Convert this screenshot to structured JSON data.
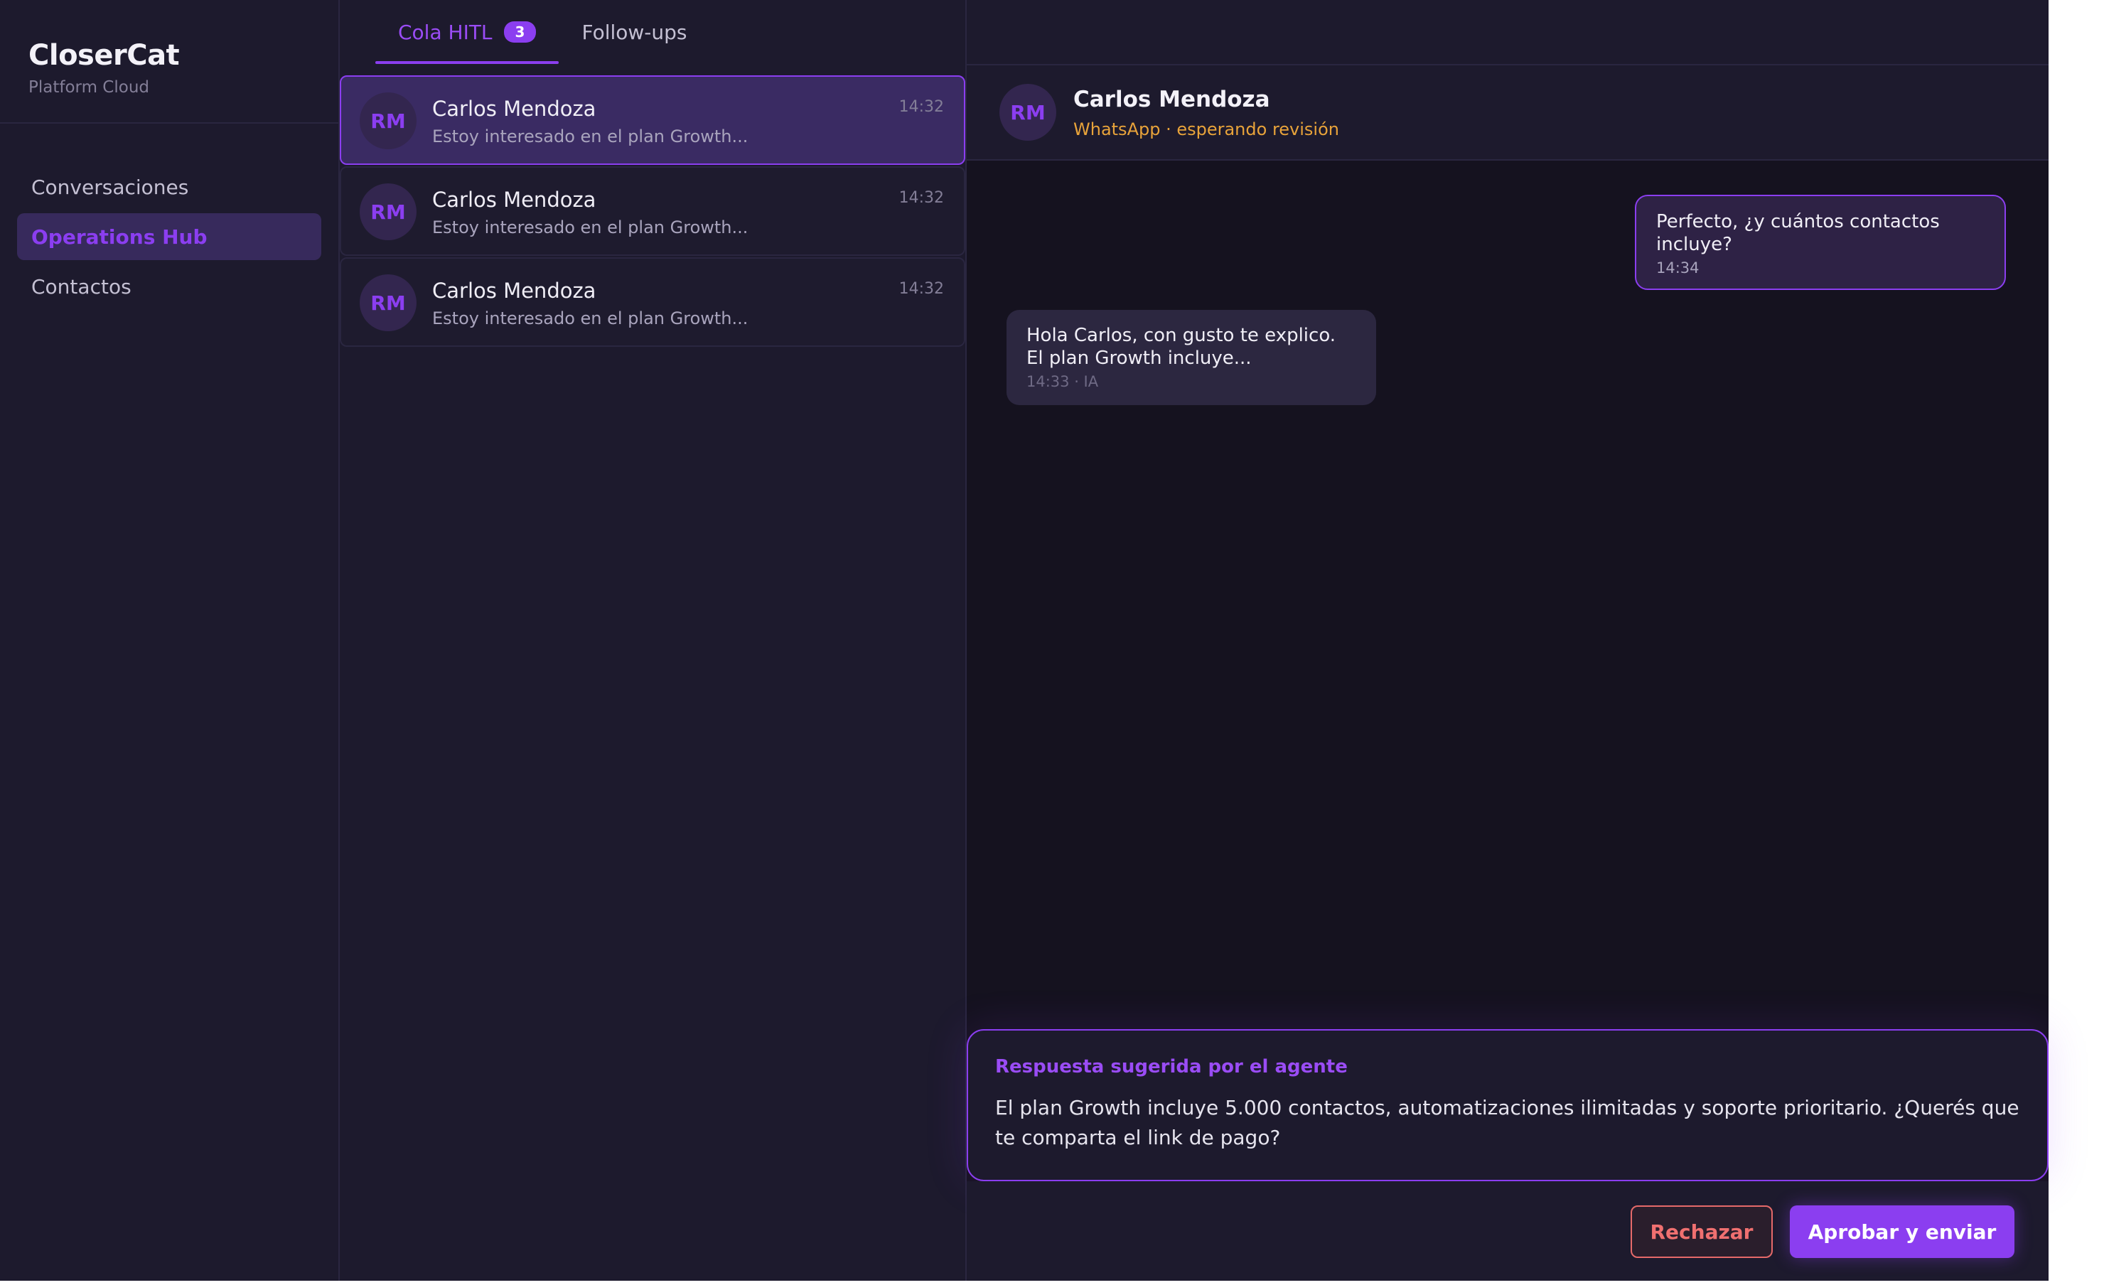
{
  "brand": {
    "title": "CloserCat",
    "subtitle": "Platform Cloud"
  },
  "nav": {
    "items": [
      {
        "label": "Conversaciones",
        "active": false
      },
      {
        "label": "Operations Hub",
        "active": true
      },
      {
        "label": "Contactos",
        "active": false
      }
    ]
  },
  "tabs": [
    {
      "label": "Cola HITL",
      "badge": "3",
      "active": true
    },
    {
      "label": "Follow-ups",
      "active": false
    }
  ],
  "conversations": [
    {
      "initials": "RM",
      "name": "Carlos Mendoza",
      "preview": "Estoy interesado en el plan Growth...",
      "time": "14:32",
      "selected": true
    },
    {
      "initials": "RM",
      "name": "Carlos Mendoza",
      "preview": "Estoy interesado en el plan Growth...",
      "time": "14:32",
      "selected": false
    },
    {
      "initials": "RM",
      "name": "Carlos Mendoza",
      "preview": "Estoy interesado en el plan Growth...",
      "time": "14:32",
      "selected": false
    }
  ],
  "chat": {
    "initials": "RM",
    "name": "Carlos Mendoza",
    "status": "WhatsApp · esperando revisión",
    "messages": [
      {
        "direction": "out",
        "text": "Perfecto, ¿y cuántos contactos incluye?",
        "meta": "14:34"
      },
      {
        "direction": "in",
        "text": "Hola Carlos, con gusto te explico. El plan Growth incluye...",
        "meta": "14:33 · IA"
      }
    ]
  },
  "suggestion": {
    "label": "Respuesta sugerida por el agente",
    "text": "El plan Growth incluye 5.000 contactos, automatizaciones ilimitadas y soporte prioritario. ¿Querés que te comparta el link de pago?"
  },
  "actions": {
    "reject_label": "Rechazar",
    "approve_label": "Aprobar y enviar"
  },
  "colors": {
    "accent": "#8b3ef0",
    "status_warning": "#e8a33a",
    "reject": "#f07070",
    "background": "#1d1a2d"
  }
}
